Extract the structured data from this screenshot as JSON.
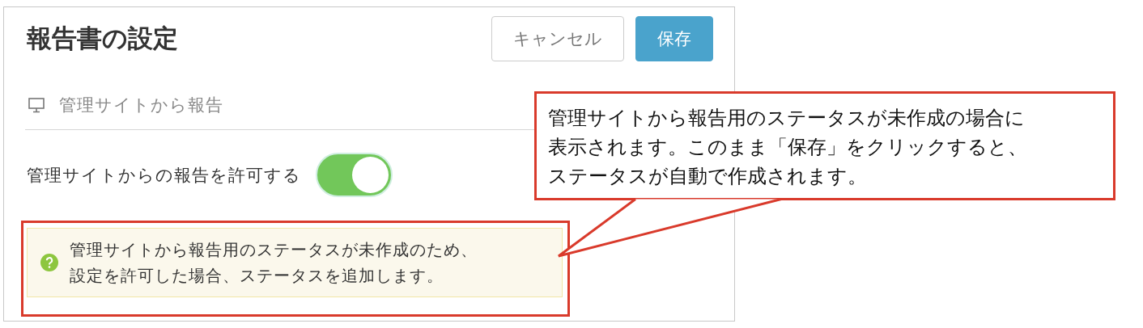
{
  "panel": {
    "title": "報告書の設定",
    "buttons": [
      {
        "label": "キャンセル",
        "kind": "secondary"
      },
      {
        "label": "保存",
        "kind": "primary"
      }
    ],
    "section": {
      "label": "管理サイトから報告"
    },
    "toggle": {
      "label": "管理サイトからの報告を許可する",
      "on": true
    },
    "notice": {
      "lines": [
        "管理サイトから報告用のステータスが未作成のため、",
        "設定を許可した場合、ステータスを追加します。"
      ]
    }
  },
  "annotation": {
    "lines": [
      "管理サイトから報告用のステータスが未作成の場合に",
      "表示されます。このまま「保存」をクリックすると、",
      "ステータスが自動で作成されます。"
    ]
  }
}
